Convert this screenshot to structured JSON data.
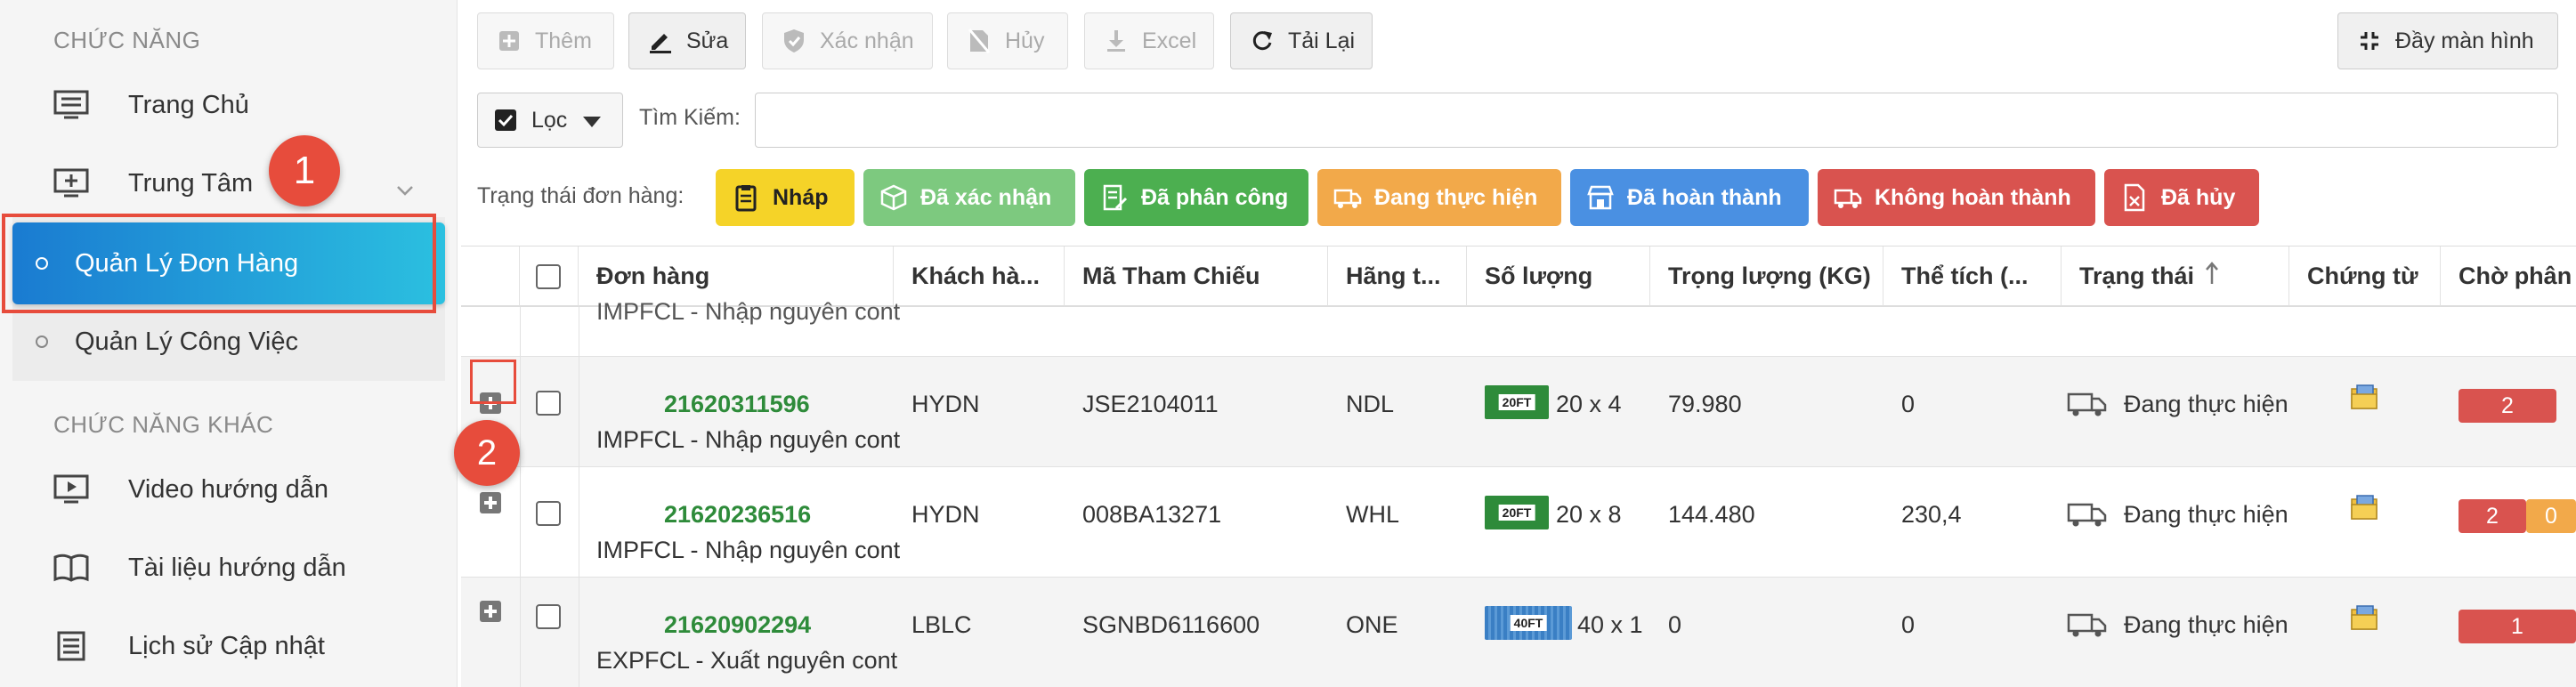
{
  "sidebar": {
    "section_main": "CHỨC NĂNG",
    "items": [
      {
        "label": "Trang Chủ",
        "icon": "monitor-list-icon"
      },
      {
        "label": "Trung Tâm",
        "icon": "monitor-plus-icon"
      }
    ],
    "sub_items": [
      {
        "label": "Quản Lý Đơn Hàng"
      },
      {
        "label": "Quản Lý Công Việc"
      }
    ],
    "section_other": "CHỨC NĂNG KHÁC",
    "other_items": [
      {
        "label": "Video hướng dẫn",
        "icon": "video-icon"
      },
      {
        "label": "Tài liệu hướng dẫn",
        "icon": "book-icon"
      },
      {
        "label": "Lịch sử Cập nhật",
        "icon": "list-icon"
      }
    ]
  },
  "callouts": [
    "1",
    "2"
  ],
  "toolbar": {
    "add": "Thêm",
    "edit": "Sửa",
    "confirm": "Xác nhận",
    "cancel": "Hủy",
    "excel": "Excel",
    "reload": "Tải Lại",
    "fullscreen": "Đầy màn hình"
  },
  "filter": {
    "label": "Lọc",
    "search_label": "Tìm Kiếm:",
    "search_value": ""
  },
  "status": {
    "label": "Trạng thái đơn hàng:",
    "buttons": [
      {
        "label": "Nháp",
        "color": "#f5d328"
      },
      {
        "label": "Đã xác nhận",
        "color": "#7dc97f"
      },
      {
        "label": "Đã phân công",
        "color": "#4caf50"
      },
      {
        "label": "Đang thực hiện",
        "color": "#f2a94a"
      },
      {
        "label": "Đã hoàn thành",
        "color": "#4a90e2"
      },
      {
        "label": "Không hoàn thành",
        "color": "#d9534f"
      },
      {
        "label": "Đã hủy",
        "color": "#d9534f"
      }
    ]
  },
  "table": {
    "headers": [
      "Đơn hàng",
      "Khách hà...",
      "Mã Tham Chiếu",
      "Hãng t...",
      "Số lượng",
      "Trọng lượng (KG)",
      "Thể tích (...",
      "Trạng thái",
      "Chứng từ",
      "Chờ phân"
    ],
    "partial_row_text": "IMPFCL - Nhập nguyên cont",
    "rows": [
      {
        "order_id": "21620311596",
        "order_type": "IMPFCL - Nhập nguyên cont",
        "customer": "HYDN",
        "ref": "JSE2104011",
        "carrier": "NDL",
        "container": "20FT",
        "qty": "20 x 4",
        "weight": "79.980",
        "volume": "0",
        "status": "Đang thực hiện",
        "pending": [
          "2"
        ]
      },
      {
        "order_id": "21620236516",
        "order_type": "IMPFCL - Nhập nguyên cont",
        "customer": "HYDN",
        "ref": "008BA13271",
        "carrier": "WHL",
        "container": "20FT",
        "qty": "20 x 8",
        "weight": "144.480",
        "volume": "230,4",
        "status": "Đang thực hiện",
        "pending": [
          "2",
          "0"
        ]
      },
      {
        "order_id": "21620902294",
        "order_type": "EXPFCL - Xuất nguyên cont",
        "customer": "LBLC",
        "ref": "SGNBD6116600",
        "carrier": "ONE",
        "container": "40FT",
        "qty": "40 x 1",
        "weight": "0",
        "volume": "0",
        "status": "Đang thực hiện",
        "pending": [
          "1"
        ]
      }
    ]
  }
}
